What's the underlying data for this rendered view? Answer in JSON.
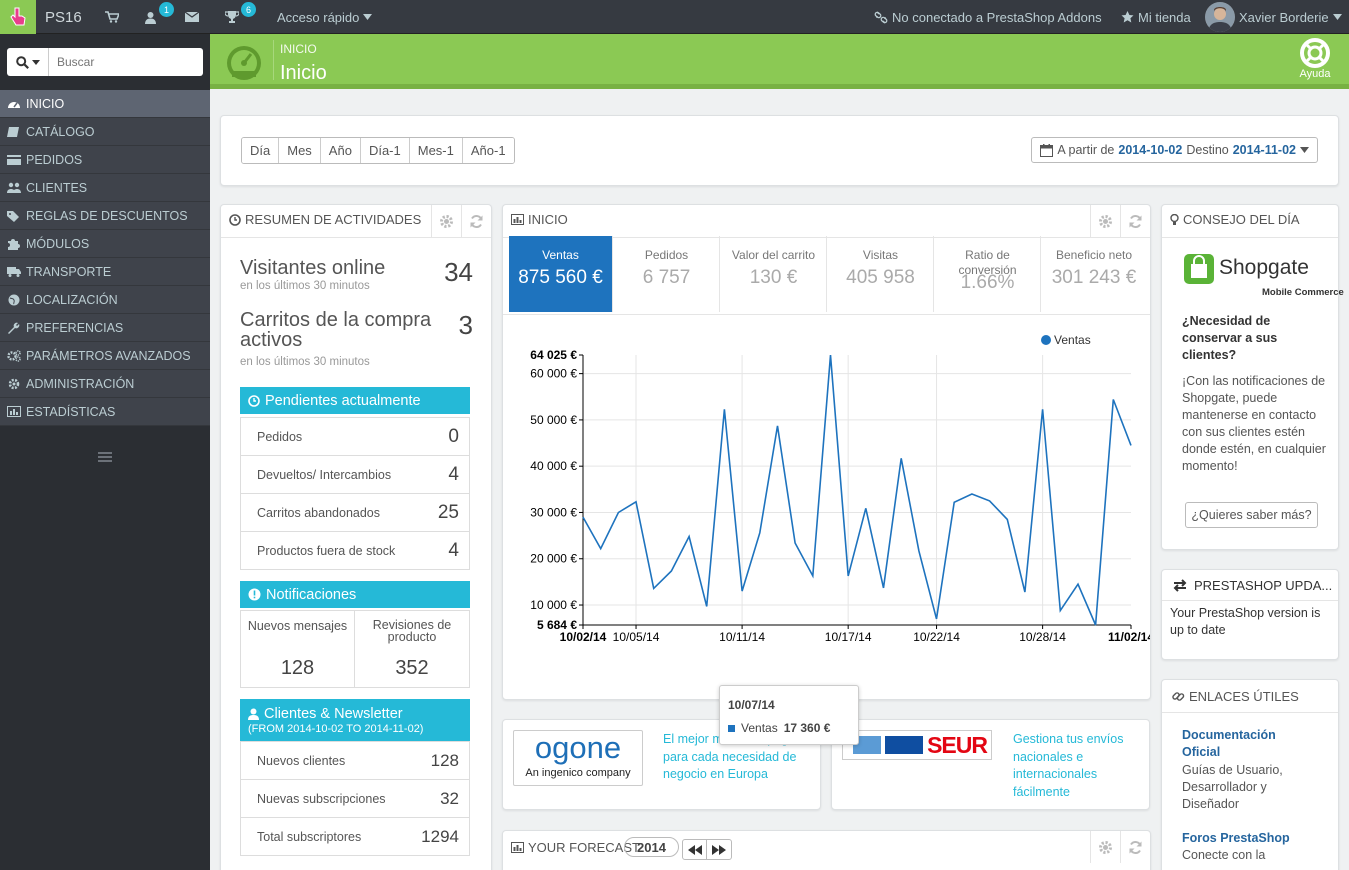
{
  "topbar": {
    "shop_name": "PS16",
    "customers_badge": "1",
    "trophy_badge": "6",
    "quick_access": "Acceso rápido",
    "addons_status": "No conectado a PrestaShop Addons",
    "my_store": "Mi tienda",
    "user_name": "Xavier Borderie"
  },
  "sidebar": {
    "search_placeholder": "Buscar",
    "items": [
      {
        "label": "INICIO",
        "icon": "dashboard-icon"
      },
      {
        "label": "CATÁLOGO",
        "icon": "book-icon"
      },
      {
        "label": "PEDIDOS",
        "icon": "credit-card-icon"
      },
      {
        "label": "CLIENTES",
        "icon": "users-icon"
      },
      {
        "label": "REGLAS DE DESCUENTOS",
        "icon": "tags-icon"
      },
      {
        "label": "MÓDULOS",
        "icon": "puzzle-icon"
      },
      {
        "label": "TRANSPORTE",
        "icon": "truck-icon"
      },
      {
        "label": "LOCALIZACIÓN",
        "icon": "globe-icon"
      },
      {
        "label": "PREFERENCIAS",
        "icon": "wrench-icon"
      },
      {
        "label": "PARÁMETROS AVANZADOS",
        "icon": "cogs-icon"
      },
      {
        "label": "ADMINISTRACIÓN",
        "icon": "cog-icon"
      },
      {
        "label": "ESTADÍSTICAS",
        "icon": "bar-chart-icon"
      }
    ]
  },
  "header": {
    "breadcrumb": "INICIO",
    "title": "Inicio",
    "help": "Ayuda",
    "accent": "#8bc954"
  },
  "toolbar": {
    "periods": [
      "Día",
      "Mes",
      "Año",
      "Día-1",
      "Mes-1",
      "Año-1"
    ],
    "date_from_label": "A partir de",
    "date_from": "2014-10-02",
    "date_to_label": "Destino",
    "date_to": "2014-11-02"
  },
  "activity": {
    "title": "RESUMEN DE ACTIVIDADES",
    "visitors_label": "Visitantes online",
    "visitors_value": "34",
    "visitors_sub": "en los últimos 30 minutos",
    "carts_label": "Carritos de la compra activos",
    "carts_value": "3",
    "carts_sub": "en los últimos 30 minutos",
    "pending_title": "Pendientes actualmente",
    "pending": [
      {
        "label": "Pedidos",
        "value": "0"
      },
      {
        "label": "Devueltos/ Intercambios",
        "value": "4"
      },
      {
        "label": "Carritos abandonados",
        "value": "25"
      },
      {
        "label": "Productos fuera de stock",
        "value": "4"
      }
    ],
    "notifications_title": "Notificaciones",
    "messages_label": "Nuevos mensajes",
    "messages_value": "128",
    "reviews_label": "Revisiones de producto",
    "reviews_value": "352",
    "clients_title": "Clientes & Newsletter",
    "clients_sub": "(FROM 2014-10-02 TO 2014-11-02)",
    "clients": [
      {
        "label": "Nuevos clientes",
        "value": "128"
      },
      {
        "label": "Nuevas subscripciones",
        "value": "32"
      },
      {
        "label": "Total subscriptores",
        "value": "1294"
      }
    ]
  },
  "dashboard": {
    "title": "INICIO",
    "kpis": [
      {
        "label": "Ventas",
        "value": "875 560 €"
      },
      {
        "label": "Pedidos",
        "value": "6 757"
      },
      {
        "label": "Valor del carrito",
        "value": "130 €"
      },
      {
        "label": "Visitas",
        "value": "405 958"
      },
      {
        "label": "Ratio de conversión",
        "value": "1.66%"
      },
      {
        "label": "Beneficio neto",
        "value": "301 243 €"
      }
    ],
    "tooltip_date": "10/07/14",
    "tooltip_series": "Ventas",
    "tooltip_value": "17 360 €"
  },
  "chart_data": {
    "type": "line",
    "series": [
      {
        "name": "Ventas",
        "color": "#1e73be"
      }
    ],
    "x": [
      "10/02/14",
      "10/03/14",
      "10/04/14",
      "10/05/14",
      "10/06/14",
      "10/07/14",
      "10/08/14",
      "10/09/14",
      "10/10/14",
      "10/11/14",
      "10/12/14",
      "10/13/14",
      "10/14/14",
      "10/15/14",
      "10/16/14",
      "10/17/14",
      "10/18/14",
      "10/19/14",
      "10/20/14",
      "10/21/14",
      "10/22/14",
      "10/23/14",
      "10/24/14",
      "10/25/14",
      "10/26/14",
      "10/27/14",
      "10/28/14",
      "10/29/14",
      "10/30/14",
      "10/31/14",
      "11/01/14",
      "11/02/14"
    ],
    "values": [
      29000,
      22200,
      30000,
      32300,
      13600,
      17360,
      24800,
      9700,
      52300,
      13000,
      25600,
      48700,
      23400,
      16300,
      64000,
      16300,
      30900,
      13700,
      41700,
      21700,
      7000,
      32200,
      34000,
      32500,
      28500,
      12800,
      52300,
      8800,
      14500,
      5684,
      54400,
      44500
    ],
    "ylim": [
      5684,
      64025
    ],
    "ytick_labels": [
      "64 025 €",
      "60 000 €",
      "50 000 €",
      "40 000 €",
      "30 000 €",
      "20 000 €",
      "10 000 €",
      "5 684 €"
    ],
    "xtick_labels": [
      "10/02/14",
      "10/05/14",
      "10/11/14",
      "10/17/14",
      "10/22/14",
      "10/28/14",
      "11/02/14"
    ],
    "legend": "top-right",
    "grid": true
  },
  "ads": {
    "ogone_text": "El mejor medio de pago para cada necesidad de negocio en Europa",
    "ogone_logo": "ogone",
    "ogone_tagline": "An ingenico company",
    "seur_logo": "SEUR",
    "seur_text": "Gestiona tus envíos nacionales e internacionales fácilmente"
  },
  "forecast": {
    "title": "YOUR FORECAST",
    "year": "2014"
  },
  "tip": {
    "title": "CONSEJO DEL DÍA",
    "brand": "Shopgate",
    "brand_sub": "Mobile Commerce",
    "question": "¿Necesidad de conservar a sus clientes?",
    "body": "¡Con las notificaciones de Shopgate, puede mantenerse en contacto con sus clientes estén donde estén, en cualquier momento!",
    "button": "¿Quieres saber más?"
  },
  "update": {
    "title": "PRESTASHOP UPDA...",
    "body": "Your PrestaShop version is up to date"
  },
  "links": {
    "title": "ENLACES ÚTILES",
    "items": [
      {
        "title": "Documentación Oficial",
        "desc": "Guías de Usuario, Desarrollador y Diseñador"
      },
      {
        "title": "Foros PrestaShop",
        "desc": "Conecte con la"
      }
    ]
  }
}
